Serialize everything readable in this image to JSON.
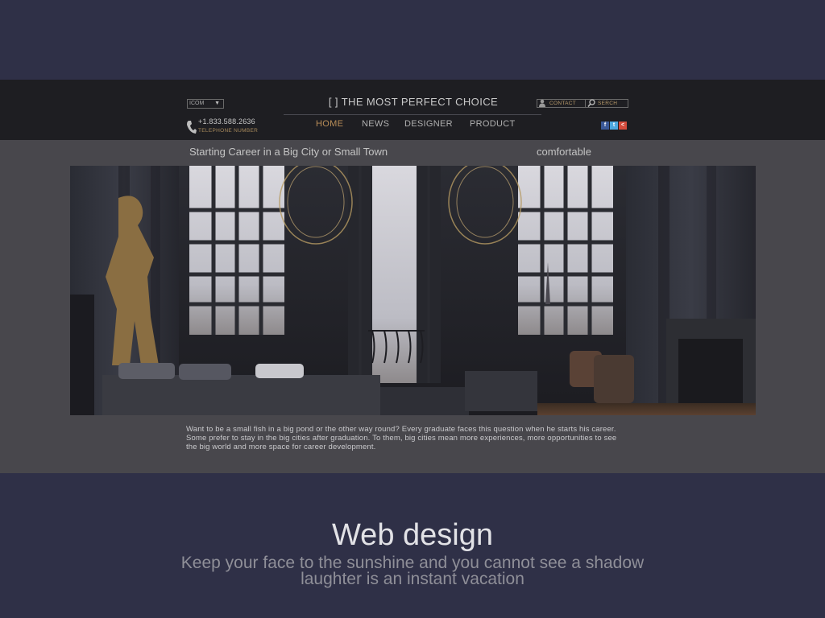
{
  "header": {
    "lang_select": {
      "value": "ICOM"
    },
    "phone": {
      "number": "+1.833.588.2636",
      "label": "TELEPHONE NUMBER"
    },
    "site_title": "[ ] THE MOST PERFECT CHOICE",
    "nav": [
      {
        "label": "HOME",
        "active": true
      },
      {
        "label": "NEWS",
        "active": false
      },
      {
        "label": "DESIGNER",
        "active": false
      },
      {
        "label": "PRODUCT",
        "active": false
      }
    ],
    "contact_label": "CONTACT",
    "search_label": "SERCH",
    "social": [
      "f",
      "t",
      "<"
    ]
  },
  "main": {
    "headline_left": "Starting Career in a Big City or Small Town",
    "headline_right": "comfortable",
    "hero_image": "dark luxury interior",
    "body": "Want to be a small fish in a big pond or the other way round? Every graduate faces this question when he starts his career. Some prefer to stay in the big cities after graduation. To them, big cities mean more experiences, more opportunities to see the big world and more space for career development."
  },
  "footer": {
    "title": "Web design",
    "subtitle_line1": "Keep your face to the sunshine and you cannot see a shadow",
    "subtitle_line2": "laughter is an instant vacation"
  },
  "colors": {
    "page_bg": "#2f3047",
    "header_bg": "#1e1e22",
    "panel_bg": "#48474c",
    "accent": "#b98e58"
  }
}
